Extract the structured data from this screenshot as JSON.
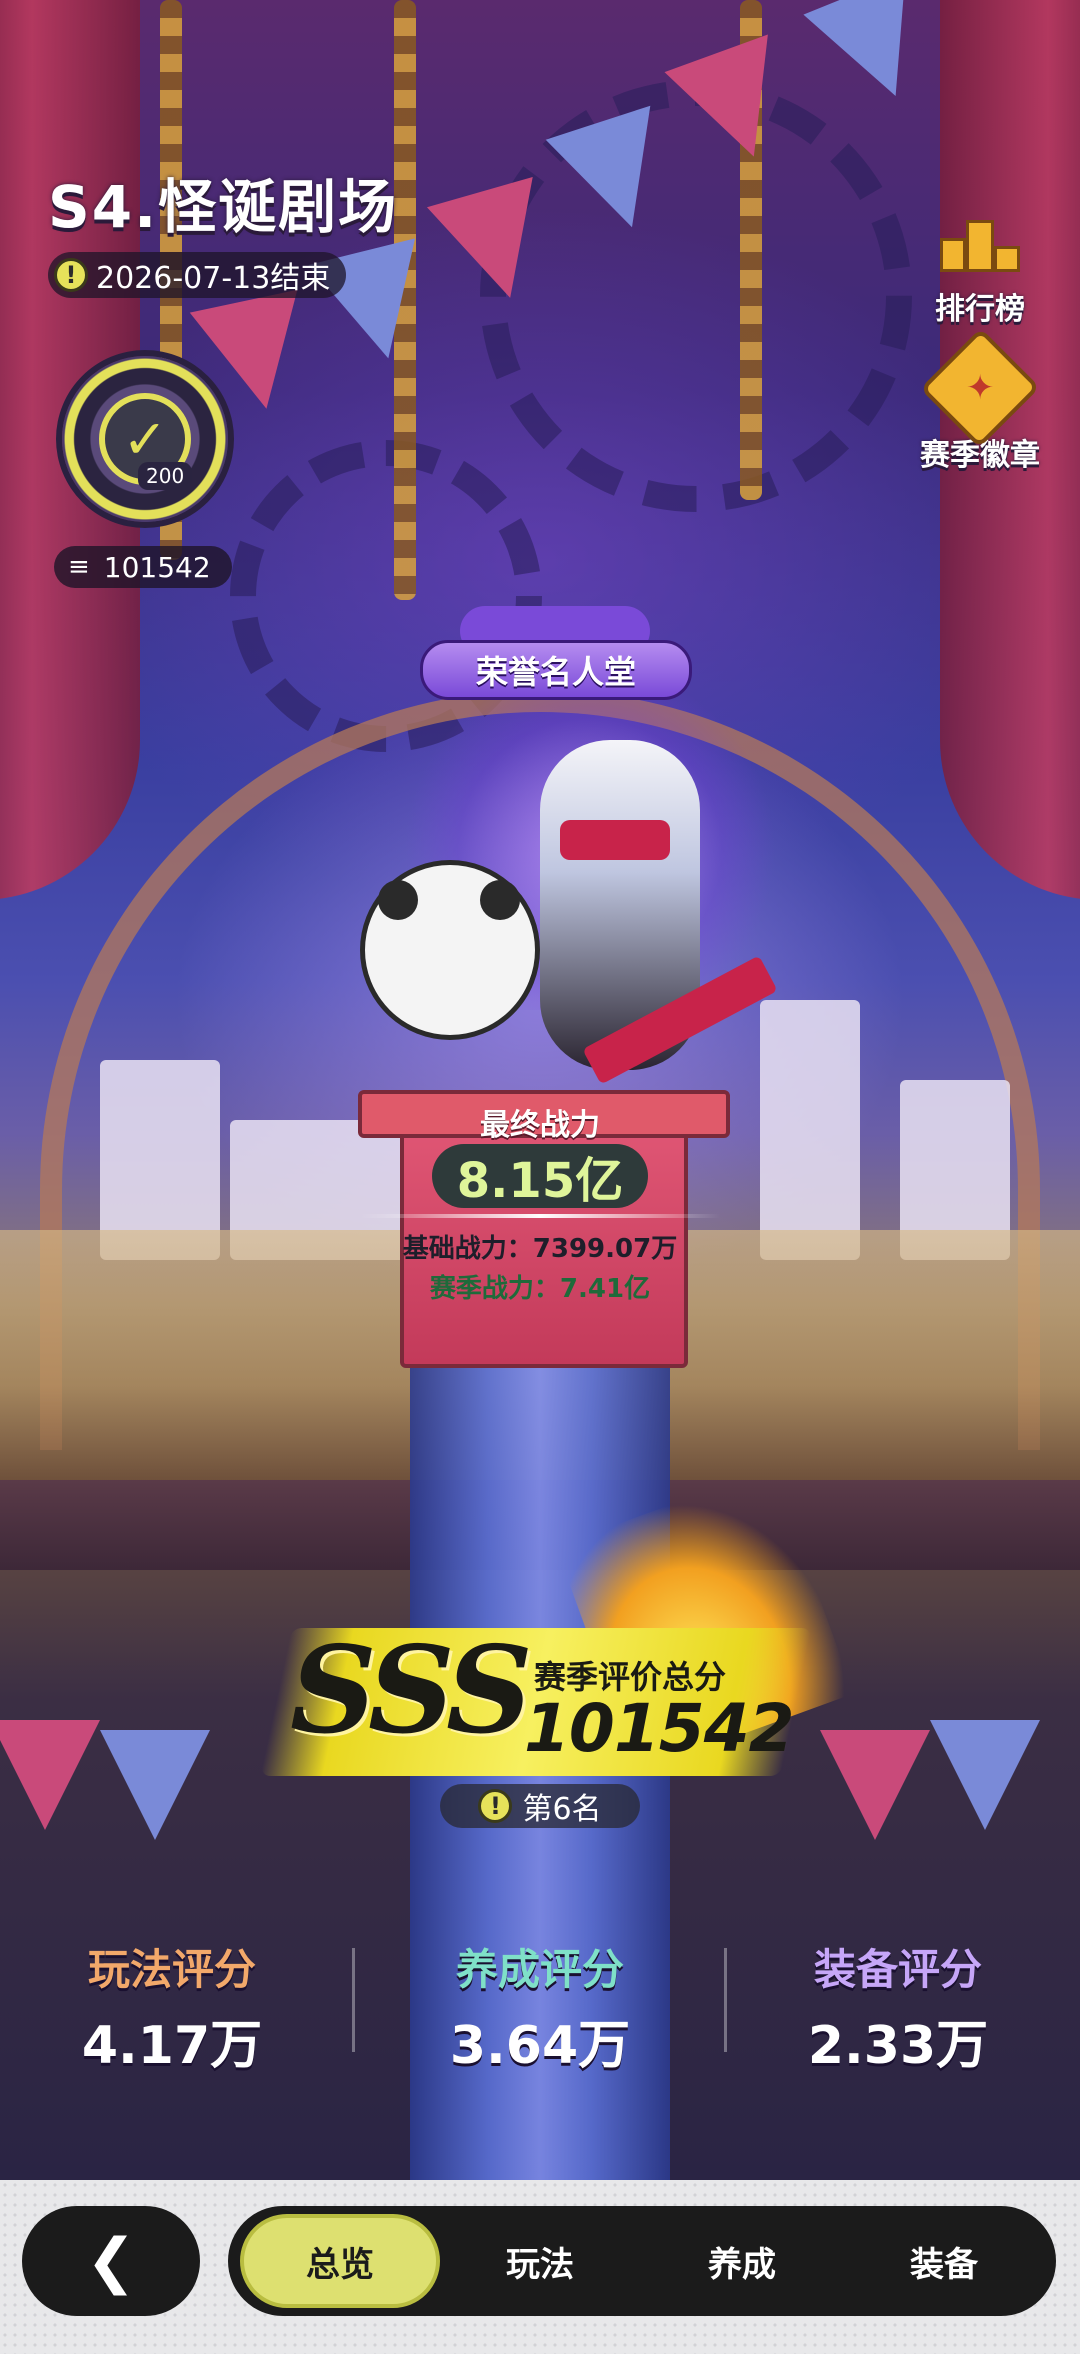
{
  "season": {
    "title": "S4.怪诞剧场",
    "end_date": "2026-07-13结束",
    "badge_level": "200",
    "total_score_small": "101542"
  },
  "side_buttons": {
    "leaderboard": "排行榜",
    "season_medal": "赛季徽章"
  },
  "hall_of_fame": "荣誉名人堂",
  "power": {
    "label": "最终战力",
    "value": "8.15亿",
    "base_label": "基础战力：",
    "base_value": "7399.07万",
    "season_label": "赛季战力：",
    "season_value": "7.41亿"
  },
  "rating": {
    "grade": "SSS",
    "subtitle": "赛季评价总分",
    "score": "101542",
    "rank": "第6名"
  },
  "stats": [
    {
      "label": "玩法评分",
      "value": "4.17万",
      "color": "#f2a86a"
    },
    {
      "label": "养成评分",
      "value": "3.64万",
      "color": "#7fe0c8"
    },
    {
      "label": "装备评分",
      "value": "2.33万",
      "color": "#c6a6f8"
    }
  ],
  "nav": {
    "back_icon": "chevron-left-icon",
    "tabs": [
      {
        "label": "总览",
        "active": true
      },
      {
        "label": "玩法",
        "active": false
      },
      {
        "label": "养成",
        "active": false
      },
      {
        "label": "装备",
        "active": false
      }
    ]
  },
  "colors": {
    "tab_active": "#dde070",
    "power_value": "#dff59a",
    "sss_gold": "#f7f060"
  }
}
